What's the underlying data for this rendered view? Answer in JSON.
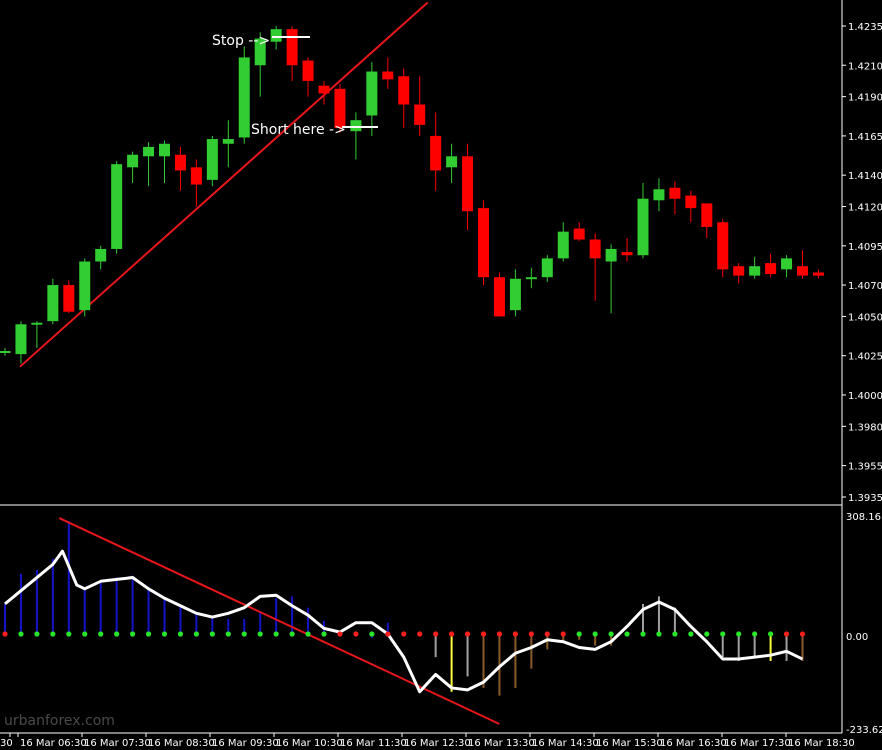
{
  "colors": {
    "background": "#000000",
    "bull": "#32CD32",
    "bear": "#FF0000",
    "trendline": "#E8161B",
    "axis_text": "#FFFFFF",
    "osc_line": "#FFFFFF",
    "hist_up": "#1414C8",
    "hist_gray": "#A0A0A0",
    "hist_yellow": "#FFFF3C",
    "hist_brown": "#8B5A2B"
  },
  "price_axis": {
    "min": 1.3925,
    "max": 1.4245,
    "labels": [
      "1.4235",
      "1.4210",
      "1.4190",
      "1.4165",
      "1.4140",
      "1.4120",
      "1.4095",
      "1.4070",
      "1.4050",
      "1.4025",
      "1.4000",
      "1.3980",
      "1.3955",
      "1.3935"
    ]
  },
  "osc_axis": {
    "max": 308.1613,
    "min": -233.621,
    "labels": [
      "308.1613",
      "0.00",
      "-233.621"
    ]
  },
  "time_axis": {
    "labels": [
      "30",
      "16 Mar 06:30",
      "16 Mar 07:30",
      "16 Mar 08:30",
      "16 Mar 09:30",
      "16 Mar 10:30",
      "16 Mar 11:30",
      "16 Mar 12:30",
      "16 Mar 13:30",
      "16 Mar 14:30",
      "16 Mar 15:30",
      "16 Mar 16:30",
      "16 Mar 17:30",
      "16 Mar 18:30"
    ]
  },
  "annotations": {
    "stop": "Stop -->",
    "short": "Short here ->"
  },
  "watermark": "urbanforex.com",
  "chart_data": [
    {
      "type": "candlestick",
      "ylim": [
        1.3925,
        1.4245
      ],
      "candles": [
        {
          "o": 1.4028,
          "h": 1.403,
          "l": 1.4025,
          "c": 1.4028
        },
        {
          "o": 1.4026,
          "h": 1.4047,
          "l": 1.402,
          "c": 1.4045
        },
        {
          "o": 1.4046,
          "h": 1.4047,
          "l": 1.403,
          "c": 1.4046
        },
        {
          "o": 1.4047,
          "h": 1.4074,
          "l": 1.4045,
          "c": 1.407
        },
        {
          "o": 1.407,
          "h": 1.4073,
          "l": 1.4052,
          "c": 1.4053
        },
        {
          "o": 1.4054,
          "h": 1.4087,
          "l": 1.405,
          "c": 1.4085
        },
        {
          "o": 1.4085,
          "h": 1.4095,
          "l": 1.408,
          "c": 1.4093
        },
        {
          "o": 1.4093,
          "h": 1.4149,
          "l": 1.409,
          "c": 1.4147
        },
        {
          "o": 1.4145,
          "h": 1.4155,
          "l": 1.4135,
          "c": 1.4153
        },
        {
          "o": 1.4152,
          "h": 1.4161,
          "l": 1.4133,
          "c": 1.4158
        },
        {
          "o": 1.4152,
          "h": 1.4162,
          "l": 1.4135,
          "c": 1.416
        },
        {
          "o": 1.4153,
          "h": 1.4158,
          "l": 1.413,
          "c": 1.4143
        },
        {
          "o": 1.4145,
          "h": 1.415,
          "l": 1.412,
          "c": 1.4134
        },
        {
          "o": 1.4137,
          "h": 1.4165,
          "l": 1.4133,
          "c": 1.4163
        },
        {
          "o": 1.416,
          "h": 1.4175,
          "l": 1.4145,
          "c": 1.4163
        },
        {
          "o": 1.4164,
          "h": 1.4222,
          "l": 1.416,
          "c": 1.4215
        },
        {
          "o": 1.421,
          "h": 1.4231,
          "l": 1.419,
          "c": 1.4227
        },
        {
          "o": 1.4225,
          "h": 1.4235,
          "l": 1.422,
          "c": 1.4233
        },
        {
          "o": 1.4233,
          "h": 1.4235,
          "l": 1.42,
          "c": 1.421
        },
        {
          "o": 1.4213,
          "h": 1.4215,
          "l": 1.419,
          "c": 1.42
        },
        {
          "o": 1.4197,
          "h": 1.42,
          "l": 1.4185,
          "c": 1.4192
        },
        {
          "o": 1.4195,
          "h": 1.4198,
          "l": 1.4167,
          "c": 1.417
        },
        {
          "o": 1.4168,
          "h": 1.418,
          "l": 1.415,
          "c": 1.4175
        },
        {
          "o": 1.4178,
          "h": 1.4212,
          "l": 1.4165,
          "c": 1.4206
        },
        {
          "o": 1.4206,
          "h": 1.4215,
          "l": 1.4195,
          "c": 1.4201
        },
        {
          "o": 1.4203,
          "h": 1.4208,
          "l": 1.417,
          "c": 1.4185
        },
        {
          "o": 1.4185,
          "h": 1.4203,
          "l": 1.4165,
          "c": 1.4172
        },
        {
          "o": 1.4165,
          "h": 1.418,
          "l": 1.413,
          "c": 1.4143
        },
        {
          "o": 1.4145,
          "h": 1.416,
          "l": 1.4135,
          "c": 1.4152
        },
        {
          "o": 1.4152,
          "h": 1.416,
          "l": 1.4105,
          "c": 1.4117
        },
        {
          "o": 1.4119,
          "h": 1.4124,
          "l": 1.407,
          "c": 1.4075
        },
        {
          "o": 1.4075,
          "h": 1.4078,
          "l": 1.405,
          "c": 1.405
        },
        {
          "o": 1.4054,
          "h": 1.408,
          "l": 1.405,
          "c": 1.4074
        },
        {
          "o": 1.4075,
          "h": 1.4081,
          "l": 1.4068,
          "c": 1.4075
        },
        {
          "o": 1.4075,
          "h": 1.4089,
          "l": 1.4072,
          "c": 1.4087
        },
        {
          "o": 1.4087,
          "h": 1.411,
          "l": 1.4085,
          "c": 1.4104
        },
        {
          "o": 1.4106,
          "h": 1.411,
          "l": 1.4098,
          "c": 1.4099
        },
        {
          "o": 1.4099,
          "h": 1.4103,
          "l": 1.406,
          "c": 1.4087
        },
        {
          "o": 1.4085,
          "h": 1.4096,
          "l": 1.4052,
          "c": 1.4093
        },
        {
          "o": 1.4091,
          "h": 1.41,
          "l": 1.4085,
          "c": 1.4089
        },
        {
          "o": 1.4089,
          "h": 1.4135,
          "l": 1.4087,
          "c": 1.4125
        },
        {
          "o": 1.4124,
          "h": 1.4138,
          "l": 1.4117,
          "c": 1.4131
        },
        {
          "o": 1.4132,
          "h": 1.4136,
          "l": 1.4115,
          "c": 1.4125
        },
        {
          "o": 1.4127,
          "h": 1.413,
          "l": 1.411,
          "c": 1.4119
        },
        {
          "o": 1.4122,
          "h": 1.4122,
          "l": 1.41,
          "c": 1.4107
        },
        {
          "o": 1.411,
          "h": 1.4112,
          "l": 1.4075,
          "c": 1.408
        },
        {
          "o": 1.4082,
          "h": 1.4084,
          "l": 1.4071,
          "c": 1.4076
        },
        {
          "o": 1.4076,
          "h": 1.4088,
          "l": 1.4074,
          "c": 1.4082
        },
        {
          "o": 1.4084,
          "h": 1.409,
          "l": 1.4075,
          "c": 1.4077
        },
        {
          "o": 1.408,
          "h": 1.4089,
          "l": 1.4075,
          "c": 1.4087
        },
        {
          "o": 1.4082,
          "h": 1.4092,
          "l": 1.4074,
          "c": 1.4076
        },
        {
          "o": 1.4078,
          "h": 1.408,
          "l": 1.4074,
          "c": 1.4076
        }
      ],
      "trendline": {
        "from": [
          0,
          1.4018
        ],
        "to": [
          26.5,
          1.425
        ]
      },
      "levels": {
        "stop": 1.4235,
        "entry": 1.4165
      }
    },
    {
      "type": "histogram",
      "ylim": [
        -233.621,
        308.1613
      ],
      "line": [
        80,
        160,
        170,
        200,
        300,
        120,
        140,
        150,
        155,
        120,
        95,
        75,
        55,
        45,
        40,
        40,
        60,
        95,
        100,
        70,
        35,
        20,
        5,
        -10,
        30,
        30,
        0,
        -60,
        -150,
        -110,
        -140,
        -160,
        -140,
        -90,
        -40,
        -20,
        -15,
        -30,
        -30,
        10,
        80,
        100,
        70,
        5,
        -70,
        -60,
        -70,
        -60,
        -70,
        -70,
        -70,
        -80
      ],
      "line_points": [
        [
          0,
          80
        ],
        [
          1,
          115
        ],
        [
          2,
          150
        ],
        [
          3,
          185
        ],
        [
          3.6,
          220
        ],
        [
          4.5,
          130
        ],
        [
          5,
          120
        ],
        [
          6,
          140
        ],
        [
          7,
          145
        ],
        [
          8,
          150
        ],
        [
          9,
          120
        ],
        [
          10,
          95
        ],
        [
          11,
          75
        ],
        [
          12,
          55
        ],
        [
          13,
          45
        ],
        [
          14,
          55
        ],
        [
          15,
          70
        ],
        [
          16,
          100
        ],
        [
          17,
          103
        ],
        [
          18,
          75
        ],
        [
          19,
          50
        ],
        [
          20,
          15
        ],
        [
          21,
          5
        ],
        [
          22,
          30
        ],
        [
          23,
          30
        ],
        [
          24,
          0
        ],
        [
          25,
          -60
        ],
        [
          26,
          -150
        ],
        [
          27,
          -105
        ],
        [
          28,
          -140
        ],
        [
          29,
          -145
        ],
        [
          30,
          -125
        ],
        [
          31,
          -85
        ],
        [
          32,
          -50
        ],
        [
          33,
          -35
        ],
        [
          34,
          -15
        ],
        [
          35,
          -20
        ],
        [
          36,
          -35
        ],
        [
          37,
          -40
        ],
        [
          38,
          -20
        ],
        [
          39,
          20
        ],
        [
          40,
          65
        ],
        [
          41,
          85
        ],
        [
          42,
          65
        ],
        [
          43,
          20
        ],
        [
          44,
          -20
        ],
        [
          45,
          -65
        ],
        [
          46,
          -65
        ],
        [
          47,
          -60
        ],
        [
          48,
          -55
        ],
        [
          49,
          -45
        ],
        [
          50,
          -65
        ]
      ],
      "bar_colors": [
        "up",
        "up",
        "up",
        "up",
        "up",
        "up",
        "up",
        "up",
        "up",
        "up",
        "up",
        "up",
        "up",
        "up",
        "up",
        "up",
        "up",
        "up",
        "up",
        "up",
        "up",
        "none",
        "none",
        "up",
        "up",
        "none",
        "gray",
        "gray",
        "yellow",
        "gray",
        "brown",
        "brown",
        "brown",
        "brown",
        "brown",
        "brown",
        "brown",
        "brown",
        "brown",
        "none",
        "gray",
        "gray",
        "gray",
        "yellow",
        "none",
        "gray",
        "gray",
        "gray",
        "yellow",
        "gray",
        "brown"
      ],
      "dot_colors": [
        "red",
        "green",
        "green",
        "green",
        "green",
        "green",
        "green",
        "green",
        "green",
        "green",
        "green",
        "green",
        "green",
        "green",
        "green",
        "green",
        "green",
        "green",
        "green",
        "green",
        "green",
        "red",
        "red",
        "green",
        "red",
        "red",
        "red",
        "red",
        "red",
        "red",
        "red",
        "red",
        "red",
        "red",
        "red",
        "red",
        "green",
        "green",
        "green",
        "green",
        "green",
        "green",
        "green",
        "green",
        "green",
        "green",
        "green",
        "green",
        "green",
        "red",
        "red"
      ],
      "trendline": {
        "from": [
          3.4,
          308
        ],
        "to": [
          31,
          -233.6
        ]
      }
    }
  ]
}
